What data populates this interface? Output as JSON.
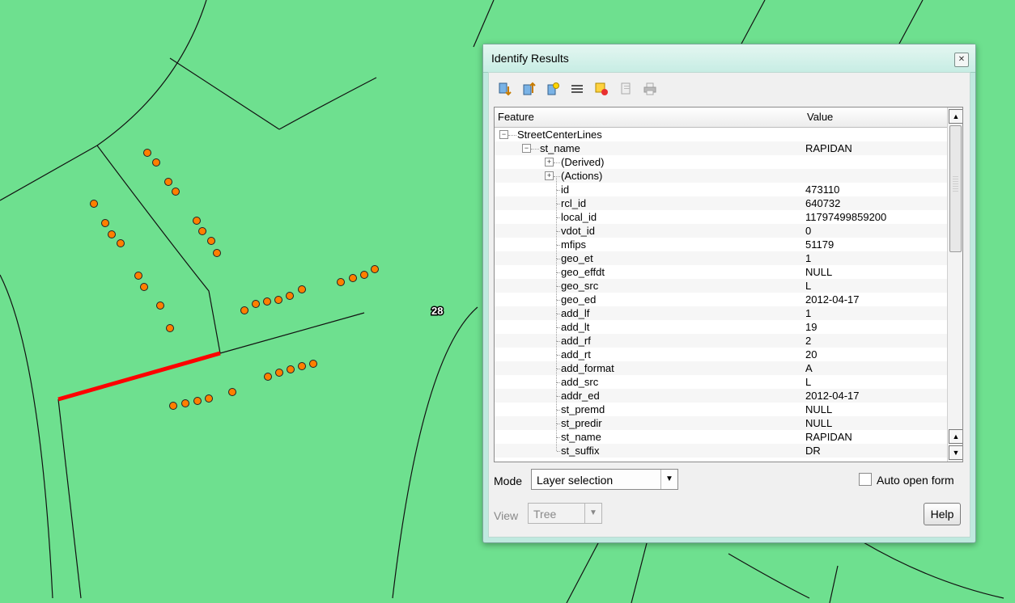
{
  "map": {
    "background": "#6ee08f",
    "highlight_color": "#ff0000",
    "point_color": "#ff7f00",
    "label": "28"
  },
  "dialog": {
    "title": "Identify Results",
    "close_icon": "close-icon",
    "toolbar": [
      {
        "name": "expand-tree-icon"
      },
      {
        "name": "collapse-tree-icon"
      },
      {
        "name": "expand-new-results-icon"
      },
      {
        "name": "open-form-icon"
      },
      {
        "name": "clear-highlight-icon"
      },
      {
        "name": "copy-feature-icon"
      },
      {
        "name": "print-icon"
      }
    ],
    "columns": {
      "feature": "Feature",
      "value": "Value"
    },
    "tree": {
      "layer": "StreetCenterLines",
      "feature": {
        "label": "st_name",
        "value": "RAPIDAN"
      },
      "groups": [
        "(Derived)",
        "(Actions)"
      ],
      "attributes": [
        {
          "label": "id",
          "value": "473110"
        },
        {
          "label": "rcl_id",
          "value": "640732"
        },
        {
          "label": "local_id",
          "value": "11797499859200"
        },
        {
          "label": "vdot_id",
          "value": "0"
        },
        {
          "label": "mfips",
          "value": "51179"
        },
        {
          "label": "geo_et",
          "value": "1"
        },
        {
          "label": "geo_effdt",
          "value": "NULL"
        },
        {
          "label": "geo_src",
          "value": "L"
        },
        {
          "label": "geo_ed",
          "value": "2012-04-17"
        },
        {
          "label": "add_lf",
          "value": "1"
        },
        {
          "label": "add_lt",
          "value": "19"
        },
        {
          "label": "add_rf",
          "value": "2"
        },
        {
          "label": "add_rt",
          "value": "20"
        },
        {
          "label": "add_format",
          "value": "A"
        },
        {
          "label": "add_src",
          "value": "L"
        },
        {
          "label": "addr_ed",
          "value": "2012-04-17"
        },
        {
          "label": "st_premd",
          "value": "NULL"
        },
        {
          "label": "st_predir",
          "value": "NULL"
        },
        {
          "label": "st_name",
          "value": "RAPIDAN"
        },
        {
          "label": "st_suffix",
          "value": "DR"
        }
      ]
    },
    "mode": {
      "label": "Mode",
      "value": "Layer selection"
    },
    "auto_open_form": {
      "label": "Auto open form",
      "checked": false
    },
    "view": {
      "label": "View",
      "value": "Tree"
    },
    "help": "Help"
  }
}
